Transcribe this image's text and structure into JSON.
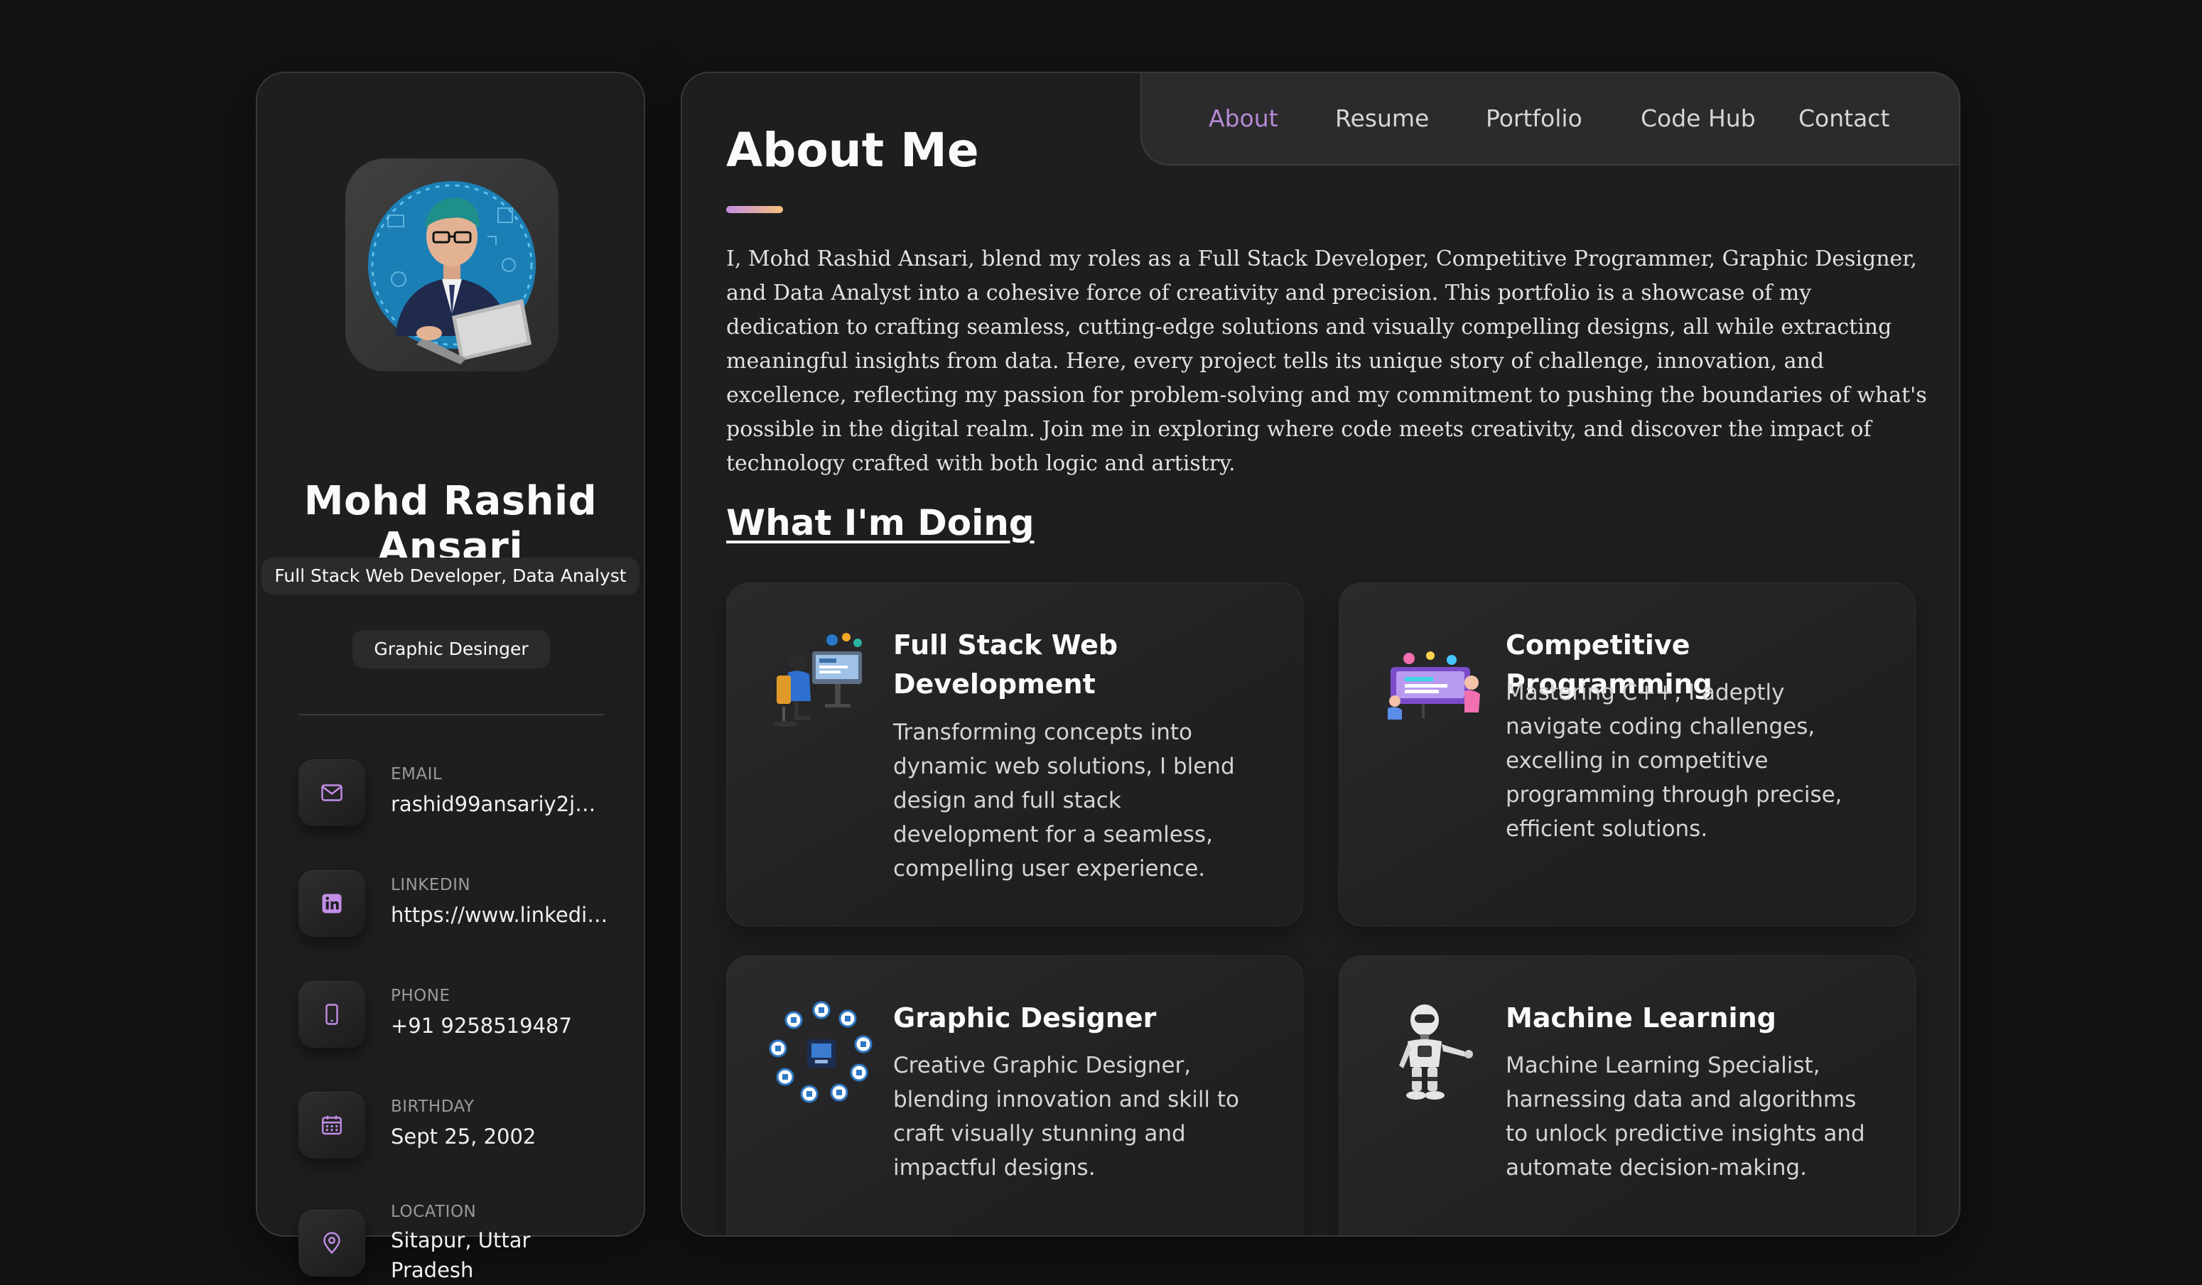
{
  "sidebar": {
    "name": "Mohd Rashid Ansari",
    "title_primary": "Full Stack Web Developer, Data Analyst",
    "title_secondary": "Graphic Desinger",
    "contacts": [
      {
        "label": "EMAIL",
        "value": "rashid99ansariy2j@...",
        "icon": "mail-icon"
      },
      {
        "label": "LINKEDIN",
        "value": "https://www.linkedin...",
        "icon": "linkedin-icon"
      },
      {
        "label": "PHONE",
        "value": "+91 9258519487",
        "icon": "phone-icon"
      },
      {
        "label": "BIRTHDAY",
        "value": "Sept 25, 2002",
        "icon": "calendar-icon"
      },
      {
        "label": "LOCATION",
        "value": "Sitapur, Uttar Pradesh",
        "icon": "location-pin-icon"
      }
    ]
  },
  "navbar": {
    "links": [
      "About",
      "Resume",
      "Portfolio",
      "Code Hub",
      "Contact"
    ],
    "active": "About"
  },
  "about": {
    "title": "About Me",
    "body": "I, Mohd Rashid Ansari, blend my roles as a Full Stack Developer, Competitive Programmer, Graphic Designer, and Data Analyst into a cohesive force of creativity and precision. This portfolio is a showcase of my dedication to crafting seamless, cutting-edge solutions and visually compelling designs, all while extracting meaningful insights from data. Here, every project tells its unique story of challenge, innovation, and excellence, reflecting my passion for problem-solving and my commitment to pushing the boundaries of what's possible in the digital realm. Join me in exploring where code meets creativity, and discover the impact of technology crafted with both logic and artistry."
  },
  "doing": {
    "title": "What I'm Doing",
    "services": [
      {
        "title": "Full Stack Web Development",
        "description": "Transforming concepts into dynamic web solutions, I blend design and full stack development for a seamless, compelling user experience.",
        "icon": "web-developer-illustration-icon"
      },
      {
        "title": "Competitive Programming",
        "description": "Mastering C++, I adeptly navigate coding challenges, excelling in competitive programming through precise, efficient solutions.",
        "icon": "coding-team-illustration-icon"
      },
      {
        "title": "Graphic Designer",
        "description": "Creative Graphic Designer, blending innovation and skill to craft visually stunning and impactful designs.",
        "icon": "design-tools-circle-icon"
      },
      {
        "title": "Machine Learning",
        "description": "Machine Learning Specialist, harnessing data and algorithms to unlock predictive insights and automate decision-making.",
        "icon": "robot-icon"
      }
    ]
  },
  "colors": {
    "accent": "#b689d4",
    "background": "#121212",
    "card": "#1e1e1f"
  }
}
